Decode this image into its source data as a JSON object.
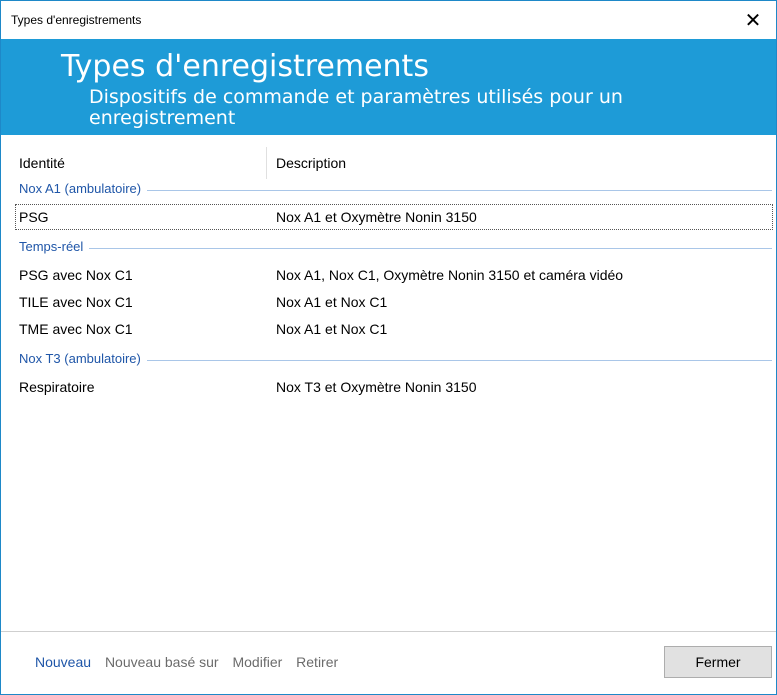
{
  "window": {
    "title": "Types d'enregistrements",
    "close_glyph": "✕"
  },
  "banner": {
    "title": "Types d'enregistrements",
    "subtitle": "Dispositifs de commande et paramètres utilisés pour un enregistrement",
    "background": "#1e9bd7"
  },
  "table": {
    "columns": [
      "Identité",
      "Description"
    ],
    "groups": [
      {
        "name": "Nox A1 (ambulatoire)",
        "rows": [
          {
            "identity": "PSG",
            "description": "Nox A1 et Oxymètre Nonin 3150",
            "selected": true
          }
        ]
      },
      {
        "name": "Temps-réel",
        "rows": [
          {
            "identity": "PSG avec Nox C1",
            "description": "Nox A1, Nox C1, Oxymètre Nonin 3150 et caméra vidéo"
          },
          {
            "identity": "TILE avec Nox C1",
            "description": "Nox A1 et Nox C1"
          },
          {
            "identity": "TME avec Nox C1",
            "description": "Nox A1 et Nox C1"
          }
        ]
      },
      {
        "name": "Nox T3 (ambulatoire)",
        "rows": [
          {
            "identity": "Respiratoire",
            "description": "Nox T3 et Oxymètre Nonin 3150"
          }
        ]
      }
    ]
  },
  "footer": {
    "new_label": "Nouveau",
    "new_based_label": "Nouveau basé sur",
    "edit_label": "Modifier",
    "remove_label": "Retirer",
    "close_button_label": "Fermer"
  }
}
